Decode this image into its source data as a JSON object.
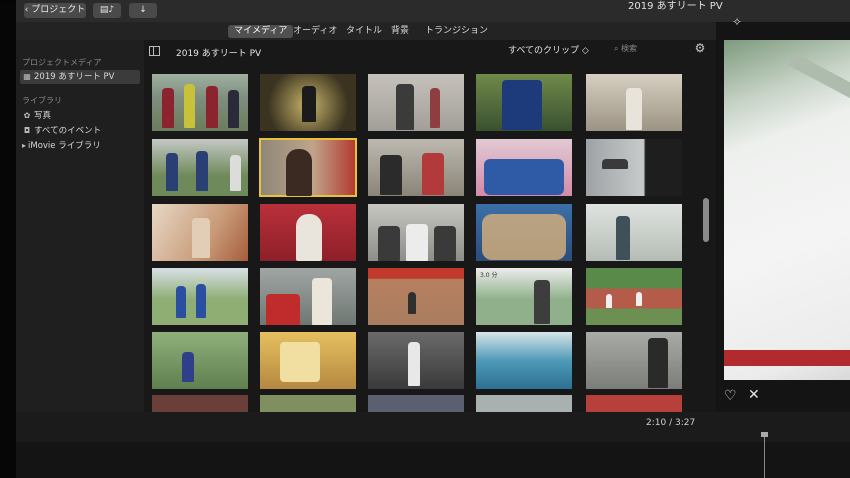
{
  "toolbar": {
    "back_label": "‹ プロジェクト",
    "media_icon": "media-browser-icon",
    "import_icon": "import-arrow-icon",
    "window_title": "2019 あすリート PV"
  },
  "tabs": [
    {
      "label": "マイメディア",
      "active": true
    },
    {
      "label": "オーディオ",
      "active": false
    },
    {
      "label": "タイトル",
      "active": false
    },
    {
      "label": "背景",
      "active": false
    },
    {
      "label": "トランジション",
      "active": false
    }
  ],
  "sidebar": {
    "project_media_header": "プロジェクトメディア",
    "project_item": "2019 あすリート PV",
    "libraries_header": "ライブラリ",
    "photos": "写真",
    "all_events": "すべてのイベント",
    "imovie_library": "iMovie ライブラリ"
  },
  "browser": {
    "title": "2019 あすリート PV",
    "clip_filter": "すべてのクリップ ◇",
    "search_placeholder": "検索",
    "settings_icon": "gear-icon",
    "thumb_caption": "3.0 分"
  },
  "viewer": {
    "favorite_icon": "heart-icon",
    "reject_icon": "x-icon"
  },
  "timeline": {
    "current_time": "2:10",
    "separator": "/",
    "total_time": "3:27"
  },
  "colors": {
    "selection": "#e8c33a",
    "active_tab": "#505050",
    "sidebar_selection": "#3b3b3b"
  }
}
